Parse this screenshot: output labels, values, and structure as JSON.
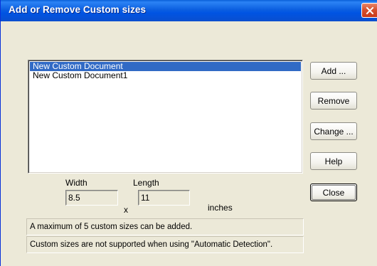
{
  "window": {
    "title": "Add or Remove Custom sizes"
  },
  "list": {
    "items": [
      {
        "label": "New Custom Document",
        "selected": true
      },
      {
        "label": "New Custom Document1",
        "selected": false
      }
    ]
  },
  "buttons": {
    "add": "Add ...",
    "remove": "Remove",
    "change": "Change ...",
    "help": "Help",
    "close": "Close"
  },
  "dimensions": {
    "width_label": "Width",
    "length_label": "Length",
    "width_value": "8.5",
    "length_value": "11",
    "separator": "x",
    "unit": "inches"
  },
  "messages": {
    "max_sizes": "A maximum of 5 custom sizes can be added.",
    "not_supported": "Custom sizes are not supported when using \"Automatic Detection\"."
  },
  "colors": {
    "titlebar": "#0054e3",
    "selection": "#316ac5",
    "dialog_bg": "#ece9d8",
    "close_button": "#d6502d"
  }
}
